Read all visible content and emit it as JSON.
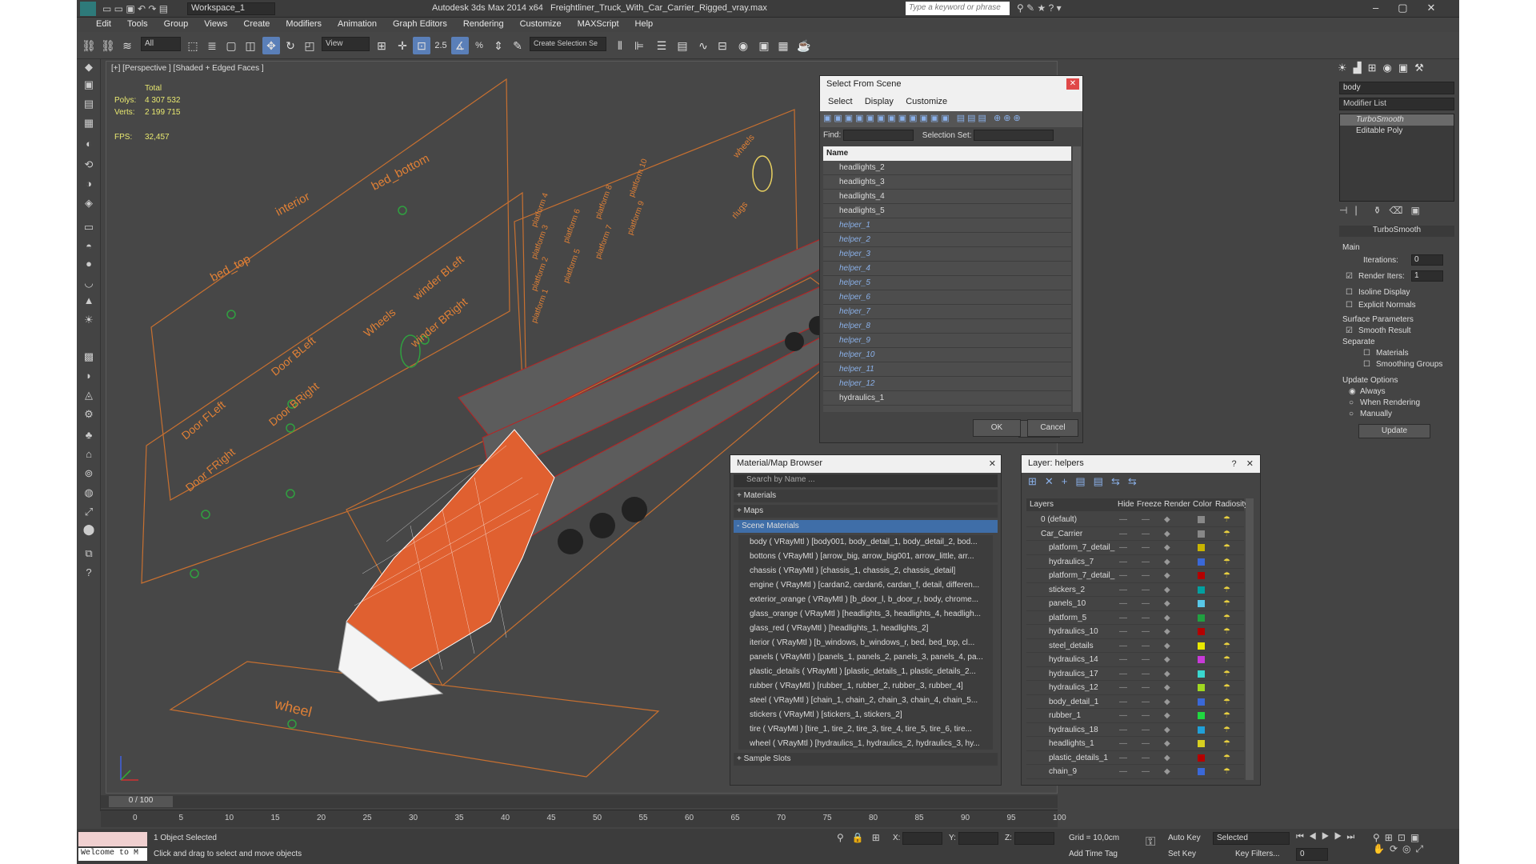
{
  "title": {
    "workspace": "Workspace_1",
    "app": "Autodesk 3ds Max 2014 x64",
    "file": "Freightliner_Truck_With_Car_Carrier_Rigged_vray.max",
    "search_placeholder": "Type a keyword or phrase"
  },
  "menu": [
    "Edit",
    "Tools",
    "Group",
    "Views",
    "Create",
    "Modifiers",
    "Animation",
    "Graph Editors",
    "Rendering",
    "Customize",
    "MAXScript",
    "Help"
  ],
  "toolbar": {
    "filter": "All",
    "ref": "View",
    "sel_set": "Create Selection Se"
  },
  "viewport": {
    "label": "[+] [Perspective ] [Shaded + Edged Faces ]",
    "stats_header": "Total",
    "polys_label": "Polys:",
    "polys": "4 307 532",
    "verts_label": "Verts:",
    "verts": "2 199 715",
    "fps_label": "FPS:",
    "fps": "32,457"
  },
  "helpers": [
    "interior",
    "bed_bottom",
    "bed_top",
    "winder BLeft",
    "winder BRight",
    "Wheels",
    "Door BLeft",
    "Door BRight",
    "Door FLeft",
    "Door FRight",
    "wheel",
    "wheels",
    "rlugs"
  ],
  "platforms": [
    "platform 1",
    "platform 2",
    "platform 3",
    "platform 4",
    "platform 5",
    "platform 6",
    "platform 7",
    "platform 8",
    "platform 9",
    "platform 10"
  ],
  "select_scene": {
    "title": "Select From Scene",
    "menu": [
      "Select",
      "Display",
      "Customize"
    ],
    "find_label": "Find:",
    "selset_label": "Selection Set:",
    "col_name": "Name",
    "items": [
      "headlights_2",
      "headlights_3",
      "headlights_4",
      "headlights_5",
      "helper_1",
      "helper_2",
      "helper_3",
      "helper_4",
      "helper_5",
      "helper_6",
      "helper_7",
      "helper_8",
      "helper_9",
      "helper_10",
      "helper_11",
      "helper_12",
      "hydraulics_1"
    ],
    "ok": "OK",
    "cancel": "Cancel"
  },
  "material_browser": {
    "title": "Material/Map Browser",
    "search": "Search by Name ...",
    "materials": "+ Materials",
    "maps": "+ Maps",
    "scene": "- Scene Materials",
    "sample": "+ Sample Slots",
    "items": [
      "body  ( VRayMtl ) [body001, body_detail_1, body_detail_2, bod...",
      "bottons  ( VRayMtl ) [arrow_big, arrow_big001, arrow_little, arr...",
      "chassis  ( VRayMtl ) [chassis_1, chassis_2, chassis_detail]",
      "engine  ( VRayMtl ) [cardan2, cardan6, cardan_f, detail, differen...",
      "exterior_orange  ( VRayMtl ) [b_door_l, b_door_r, body, chrome...",
      "glass_orange  ( VRayMtl ) [headlights_3, headlights_4, headligh...",
      "glass_red  ( VRayMtl ) [headlights_1, headlights_2]",
      "iterior  ( VRayMtl ) [b_windows, b_windows_r, bed, bed_top, cl...",
      "panels  ( VRayMtl ) [panels_1, panels_2, panels_3, panels_4, pa...",
      "plastic_details  ( VRayMtl ) [plastic_details_1, plastic_details_2...",
      "rubber  ( VRayMtl ) [rubber_1, rubber_2, rubber_3, rubber_4]",
      "steel  ( VRayMtl ) [chain_1, chain_2, chain_3, chain_4, chain_5...",
      "stickers  ( VRayMtl ) [stickers_1, stickers_2]",
      "tire  ( VRayMtl ) [tire_1, tire_2, tire_3, tire_4, tire_5, tire_6, tire...",
      "wheel  ( VRayMtl ) [hydraulics_1, hydraulics_2, hydraulics_3, hy..."
    ]
  },
  "layer": {
    "title": "Layer: helpers",
    "cols": [
      "Layers",
      "Hide",
      "Freeze",
      "Render",
      "Color",
      "Radiosity"
    ],
    "items": [
      "0 (default)",
      "Car_Carrier",
      "platform_7_detail_",
      "hydraulics_7",
      "platform_7_detail_",
      "stickers_2",
      "panels_10",
      "platform_5",
      "hydraulics_10",
      "steel_details",
      "hydraulics_14",
      "hydraulics_17",
      "hydraulics_12",
      "body_detail_1",
      "rubber_1",
      "hydraulics_18",
      "headlights_1",
      "plastic_details_1",
      "chain_9"
    ],
    "colors": [
      "#888888",
      "#888888",
      "#c8b400",
      "#3a68d8",
      "#b40000",
      "#00a0a0",
      "#58c8e8",
      "#20a040",
      "#b40000",
      "#e8e800",
      "#c83ad8",
      "#3ad8d0",
      "#a0d820",
      "#3a68d8",
      "#20d840",
      "#20a0d8",
      "#d8d020",
      "#b40000",
      "#3a68d8"
    ]
  },
  "modify": {
    "name": "body",
    "list": "Modifier List",
    "stack": [
      "TurboSmooth",
      "Editable Poly"
    ],
    "rollout": "TurboSmooth",
    "main": "Main",
    "iterations_label": "Iterations:",
    "iterations": "0",
    "render_iters_label": "Render Iters:",
    "render_iters": "1",
    "isoline": "Isoline Display",
    "explicit": "Explicit Normals",
    "surface": "Surface Parameters",
    "smooth": "Smooth Result",
    "separate": "Separate",
    "materials": "Materials",
    "groups": "Smoothing Groups",
    "update_opts": "Update Options",
    "always": "Always",
    "when_rendering": "When Rendering",
    "manually": "Manually",
    "update": "Update"
  },
  "timeline": {
    "frame": "0 / 100",
    "ticks": [
      "0",
      "5",
      "10",
      "15",
      "20",
      "25",
      "30",
      "35",
      "40",
      "45",
      "50",
      "55",
      "60",
      "65",
      "70",
      "75",
      "80",
      "85",
      "90",
      "95",
      "100"
    ]
  },
  "status": {
    "selected": "1 Object Selected",
    "hint": "Click and drag to select and move objects",
    "welcome": "Welcome to M",
    "x": "X:",
    "y": "Y:",
    "z": "Z:",
    "grid": "Grid = 10,0cm",
    "autokey": "Auto Key",
    "setkey": "Set Key",
    "selected_dd": "Selected",
    "keyfilters": "Key Filters...",
    "addtag": "Add Time Tag",
    "frame": "0"
  }
}
